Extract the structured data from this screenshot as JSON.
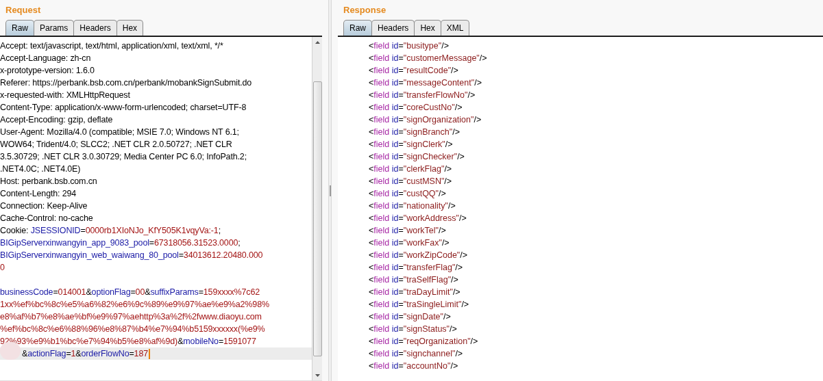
{
  "request": {
    "title": "Request",
    "tabs": [
      {
        "label": "Raw",
        "selected": true
      },
      {
        "label": "Params",
        "selected": false
      },
      {
        "label": "Headers",
        "selected": false
      },
      {
        "label": "Hex",
        "selected": false
      }
    ],
    "lines": [
      {
        "kind": "text",
        "current": false,
        "redacted": false,
        "segments": [
          {
            "kind": "plain",
            "text": "Accept: text/javascript, text/html, application/xml, text/xml, */*"
          }
        ]
      },
      {
        "kind": "text",
        "current": false,
        "redacted": false,
        "segments": [
          {
            "kind": "plain",
            "text": "Accept-Language: zh-cn"
          }
        ]
      },
      {
        "kind": "text",
        "current": false,
        "redacted": false,
        "segments": [
          {
            "kind": "plain",
            "text": "x-prototype-version: 1.6.0"
          }
        ]
      },
      {
        "kind": "text",
        "current": false,
        "redacted": false,
        "segments": [
          {
            "kind": "plain",
            "text": "Referer: https://perbank.bsb.com.cn/perbank/mobankSignSubmit.do"
          }
        ]
      },
      {
        "kind": "text",
        "current": false,
        "redacted": false,
        "segments": [
          {
            "kind": "plain",
            "text": "x-requested-with: XMLHttpRequest"
          }
        ]
      },
      {
        "kind": "text",
        "current": false,
        "redacted": false,
        "segments": [
          {
            "kind": "plain",
            "text": "Content-Type: application/x-www-form-urlencoded; charset=UTF-8"
          }
        ]
      },
      {
        "kind": "text",
        "current": false,
        "redacted": false,
        "segments": [
          {
            "kind": "plain",
            "text": "Accept-Encoding: gzip, deflate"
          }
        ]
      },
      {
        "kind": "text",
        "current": false,
        "redacted": false,
        "segments": [
          {
            "kind": "plain",
            "text": "User-Agent: Mozilla/4.0 (compatible; MSIE 7.0; Windows NT 6.1;"
          }
        ]
      },
      {
        "kind": "text",
        "current": false,
        "redacted": false,
        "segments": [
          {
            "kind": "plain",
            "text": "WOW64; Trident/4.0; SLCC2; .NET CLR 2.0.50727; .NET CLR"
          }
        ]
      },
      {
        "kind": "text",
        "current": false,
        "redacted": false,
        "segments": [
          {
            "kind": "plain",
            "text": "3.5.30729; .NET CLR 3.0.30729; Media Center PC 6.0; InfoPath.2;"
          }
        ]
      },
      {
        "kind": "text",
        "current": false,
        "redacted": false,
        "segments": [
          {
            "kind": "plain",
            "text": ".NET4.0C; .NET4.0E)"
          }
        ]
      },
      {
        "kind": "text",
        "current": false,
        "redacted": false,
        "segments": [
          {
            "kind": "plain",
            "text": "Host: perbank.bsb.com.cn"
          }
        ]
      },
      {
        "kind": "text",
        "current": false,
        "redacted": false,
        "segments": [
          {
            "kind": "plain",
            "text": "Content-Length: 294"
          }
        ]
      },
      {
        "kind": "text",
        "current": false,
        "redacted": false,
        "segments": [
          {
            "kind": "plain",
            "text": "Connection: Keep-Alive"
          }
        ]
      },
      {
        "kind": "text",
        "current": false,
        "redacted": false,
        "segments": [
          {
            "kind": "plain",
            "text": "Cache-Control: no-cache"
          }
        ]
      },
      {
        "kind": "text",
        "current": false,
        "redacted": false,
        "segments": [
          {
            "kind": "plain",
            "text": "Cookie: "
          },
          {
            "kind": "key",
            "text": "JSESSIONID"
          },
          {
            "kind": "plain",
            "text": "="
          },
          {
            "kind": "value",
            "text": "0000rb1XIoNJo_KfY505K1vqyVa:-1"
          },
          {
            "kind": "plain",
            "text": ";"
          }
        ]
      },
      {
        "kind": "text",
        "current": false,
        "redacted": false,
        "segments": [
          {
            "kind": "key",
            "text": "BIGipServerxinwangyin_app_9083_pool"
          },
          {
            "kind": "plain",
            "text": "="
          },
          {
            "kind": "value",
            "text": "67318056.31523.0000"
          },
          {
            "kind": "plain",
            "text": ";"
          }
        ]
      },
      {
        "kind": "text",
        "current": false,
        "redacted": false,
        "segments": [
          {
            "kind": "key",
            "text": "BIGipServerxinwangyin_web_waiwang_80_pool"
          },
          {
            "kind": "plain",
            "text": "="
          },
          {
            "kind": "value",
            "text": "34013612.20480.000"
          }
        ]
      },
      {
        "kind": "text",
        "current": false,
        "redacted": false,
        "segments": [
          {
            "kind": "value",
            "text": "0"
          }
        ]
      },
      {
        "kind": "blank"
      },
      {
        "kind": "text",
        "current": false,
        "redacted": false,
        "segments": [
          {
            "kind": "key",
            "text": "businessCode"
          },
          {
            "kind": "plain",
            "text": "="
          },
          {
            "kind": "value",
            "text": "014001"
          },
          {
            "kind": "plain",
            "text": "&"
          },
          {
            "kind": "key",
            "text": "optionFlag"
          },
          {
            "kind": "plain",
            "text": "="
          },
          {
            "kind": "value",
            "text": "00"
          },
          {
            "kind": "plain",
            "text": "&"
          },
          {
            "kind": "key",
            "text": "suffixParams"
          },
          {
            "kind": "plain",
            "text": "="
          },
          {
            "kind": "value",
            "text": "159xxxx%7c62"
          }
        ]
      },
      {
        "kind": "text",
        "current": false,
        "redacted": false,
        "segments": [
          {
            "kind": "value",
            "text": "1xx%ef%bc%8c%e5%a6%82%e6%9c%89%e9%97%ae%e9%a2%98%"
          }
        ]
      },
      {
        "kind": "text",
        "current": false,
        "redacted": false,
        "segments": [
          {
            "kind": "value",
            "text": "e8%af%b7%e8%ae%bf%e9%97%aehttp%3a%2f%2fwww.diaoyu.com"
          }
        ]
      },
      {
        "kind": "text",
        "current": false,
        "redacted": false,
        "segments": [
          {
            "kind": "value",
            "text": "%ef%bc%8c%e6%88%96%e8%87%b4%e7%94%b5159xxxxxx(%e9%"
          }
        ]
      },
      {
        "kind": "text",
        "current": false,
        "redacted": false,
        "segments": [
          {
            "kind": "value",
            "text": "92%93%e9%b1%bc%e7%94%b5%e8%af%9d)"
          },
          {
            "kind": "plain",
            "text": "&"
          },
          {
            "kind": "key",
            "text": "mobileNo"
          },
          {
            "kind": "plain",
            "text": "="
          },
          {
            "kind": "value",
            "text": "1591077"
          }
        ]
      },
      {
        "kind": "text",
        "current": true,
        "redacted": true,
        "segments": [
          {
            "kind": "plain",
            "text": "&"
          },
          {
            "kind": "key",
            "text": "actionFlag"
          },
          {
            "kind": "plain",
            "text": "="
          },
          {
            "kind": "value",
            "text": "1"
          },
          {
            "kind": "plain",
            "text": "&"
          },
          {
            "kind": "key",
            "text": "orderFlowNo"
          },
          {
            "kind": "plain",
            "text": "="
          },
          {
            "kind": "value",
            "text": "187"
          }
        ]
      }
    ]
  },
  "response": {
    "title": "Response",
    "tabs": [
      {
        "label": "Raw",
        "selected": true
      },
      {
        "label": "Headers",
        "selected": false
      },
      {
        "label": "Hex",
        "selected": false
      },
      {
        "label": "XML",
        "selected": false
      }
    ],
    "lines": [
      "<field id=\"busitype\"/>",
      "<field id=\"customerMessage\"/>",
      "<field id=\"resultCode\"/>",
      "<field id=\"messageContent\"/>",
      "<field id=\"transferFlowNo\"/>",
      "<field id=\"coreCustNo\"/>",
      "<field id=\"signOrganization\"/>",
      "<field id=\"signBranch\"/>",
      "<field id=\"signClerk\"/>",
      "<field id=\"signChecker\"/>",
      "<field id=\"clerkFlag\"/>",
      "<field id=\"custMSN\"/>",
      "<field id=\"custQQ\"/>",
      "<field id=\"nationality\"/>",
      "<field id=\"workAddress\"/>",
      "<field id=\"workTel\"/>",
      "<field id=\"workFax\"/>",
      "<field id=\"workZipCode\"/>",
      "<field id=\"transferFlag\"/>",
      "<field id=\"traSelfFlag\"/>",
      "<field id=\"traDayLimit\"/>",
      "<field id=\"traSingleLimit\"/>",
      "<field id=\"signDate\"/>",
      "<field id=\"signStatus\"/>",
      "<field id=\"reqOrganization\"/>",
      "<field id=\"signchannel\"/>",
      "<field id=\"accountNo\"/>"
    ]
  }
}
